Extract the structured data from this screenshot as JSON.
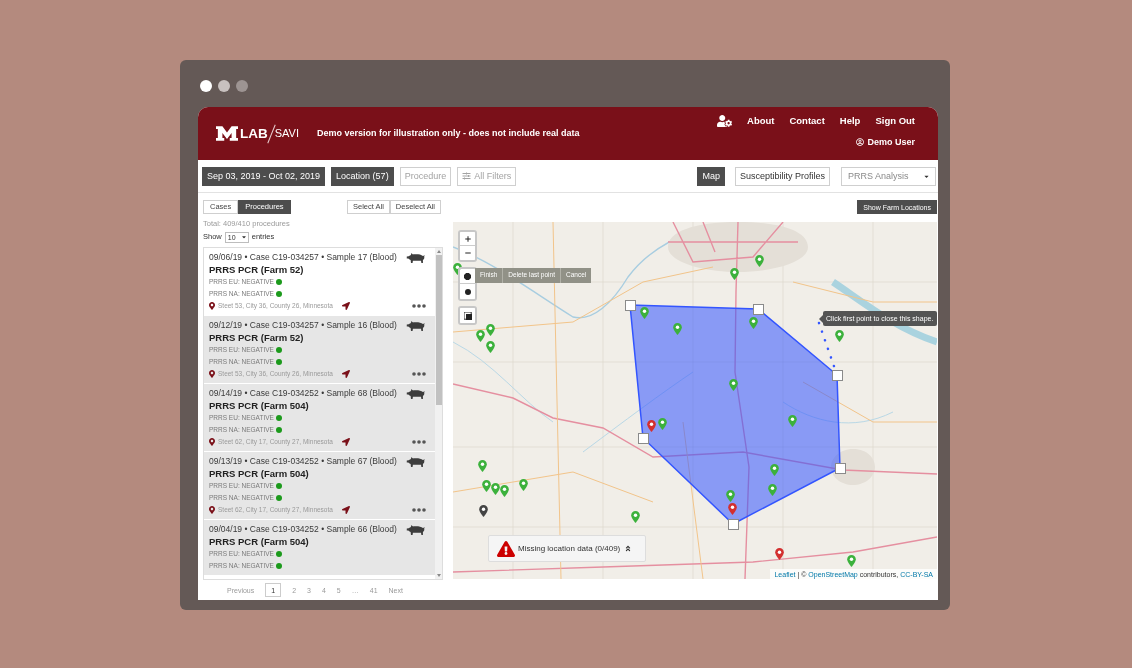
{
  "header": {
    "logo": {
      "primary": "LAB",
      "secondary": "SAVI"
    },
    "tagline": "Demo version for illustration only - does not include real data",
    "nav": [
      "About",
      "Contact",
      "Help",
      "Sign Out"
    ],
    "user": "Demo User"
  },
  "filters": [
    {
      "label": "Sep 03, 2019 - Oct 02, 2019",
      "active": true,
      "kind": "button"
    },
    {
      "label": "Location (57)",
      "active": true,
      "kind": "button"
    },
    {
      "label": "Procedure",
      "active": false,
      "kind": "button"
    },
    {
      "label": "All Filters",
      "active": false,
      "kind": "icon_button"
    }
  ],
  "views": [
    {
      "label": "Map",
      "selected": true
    },
    {
      "label": "Susceptibility Profiles",
      "selected": false
    }
  ],
  "analysis_select": {
    "value": "PRRS Analysis"
  },
  "list_tabs": [
    {
      "label": "Cases",
      "selected": false
    },
    {
      "label": "Procedures",
      "selected": true
    }
  ],
  "selection_buttons": [
    "Select All",
    "Deselect All"
  ],
  "total": "Total: 409/410 procedures",
  "page_length": {
    "prefix": "Show",
    "value": "10",
    "suffix": "entries"
  },
  "items": [
    {
      "header": "09/06/19 • Case C19-034257 • Sample 17 (Blood)",
      "title": "PRRS PCR (Farm 52)",
      "selected": true,
      "results": [
        {
          "label": "PRRS EU: NEGATIVE",
          "color": "#1c9a1c"
        },
        {
          "label": "PRRS NA: NEGATIVE",
          "color": "#1c9a1c"
        }
      ],
      "address": "Steet 53, City 36, County 26, Minnesota"
    },
    {
      "header": "09/12/19 • Case C19-034257 • Sample 16 (Blood)",
      "title": "PRRS PCR (Farm 52)",
      "selected": false,
      "results": [
        {
          "label": "PRRS EU: NEGATIVE",
          "color": "#1c9a1c"
        },
        {
          "label": "PRRS NA: NEGATIVE",
          "color": "#1c9a1c"
        }
      ],
      "address": "Steet 53, City 36, County 26, Minnesota"
    },
    {
      "header": "09/14/19 • Case C19-034252 • Sample 68 (Blood)",
      "title": "PRRS PCR (Farm 504)",
      "selected": false,
      "results": [
        {
          "label": "PRRS EU: NEGATIVE",
          "color": "#1c9a1c"
        },
        {
          "label": "PRRS NA: NEGATIVE",
          "color": "#1c9a1c"
        }
      ],
      "address": "Steet 62, City 17, County 27, Minnesota"
    },
    {
      "header": "09/13/19 • Case C19-034252 • Sample 67 (Blood)",
      "title": "PRRS PCR (Farm 504)",
      "selected": false,
      "results": [
        {
          "label": "PRRS EU: NEGATIVE",
          "color": "#1c9a1c"
        },
        {
          "label": "PRRS NA: NEGATIVE",
          "color": "#1c9a1c"
        }
      ],
      "address": "Steet 62, City 17, County 27, Minnesota"
    },
    {
      "header": "09/04/19 • Case C19-034252 • Sample 66 (Blood)",
      "title": "PRRS PCR (Farm 504)",
      "selected": false,
      "results": [
        {
          "label": "PRRS EU: NEGATIVE",
          "color": "#1c9a1c"
        },
        {
          "label": "PRRS NA: NEGATIVE",
          "color": "#1c9a1c"
        }
      ]
    }
  ],
  "pagination": [
    {
      "label": "Previous",
      "selected": false
    },
    {
      "label": "1",
      "selected": true
    },
    {
      "label": "2",
      "selected": false
    },
    {
      "label": "3",
      "selected": false
    },
    {
      "label": "4",
      "selected": false
    },
    {
      "label": "5",
      "selected": false
    },
    {
      "label": "…",
      "selected": false
    },
    {
      "label": "41",
      "selected": false
    },
    {
      "label": "Next",
      "selected": false
    }
  ],
  "map": {
    "show_farms_button": "Show Farm Locations",
    "draw_actions": [
      "Finish",
      "Delete last point",
      "Cancel"
    ],
    "tooltip": "Click first point to close this shape.",
    "missing_notice": "Missing location data (0/409)",
    "attribution": {
      "links": [
        "Leaflet",
        "OpenStreetMap",
        "CC-BY-SA"
      ],
      "separator": "| ©",
      "suffix": "contributors,"
    },
    "markers": [
      {
        "color": "#3cb13c"
      },
      {
        "color": "#3cb13c"
      },
      {
        "color": "#3cb13c"
      },
      {
        "color": "#3cb13c"
      },
      {
        "color": "#3cb13c"
      },
      {
        "color": "#3cb13c"
      },
      {
        "color": "#3cb13c"
      },
      {
        "color": "#3cb13c"
      },
      {
        "color": "#3cb13c"
      },
      {
        "color": "#3cb13c"
      },
      {
        "color": "#3cb13c"
      },
      {
        "color": "#3cb13c"
      },
      {
        "color": "#3cb13c"
      },
      {
        "color": "#d32f2f"
      },
      {
        "color": "#3cb13c"
      },
      {
        "color": "#3cb13c"
      },
      {
        "color": "#3cb13c"
      },
      {
        "color": "#3cb13c"
      },
      {
        "color": "#3cb13c"
      },
      {
        "color": "#444444"
      },
      {
        "color": "#3cb13c"
      },
      {
        "color": "#3cb13c"
      },
      {
        "color": "#3cb13c"
      },
      {
        "color": "#3cb13c"
      },
      {
        "color": "#d32f2f"
      },
      {
        "color": "#d32f2f"
      },
      {
        "color": "#3cb13c"
      }
    ]
  }
}
